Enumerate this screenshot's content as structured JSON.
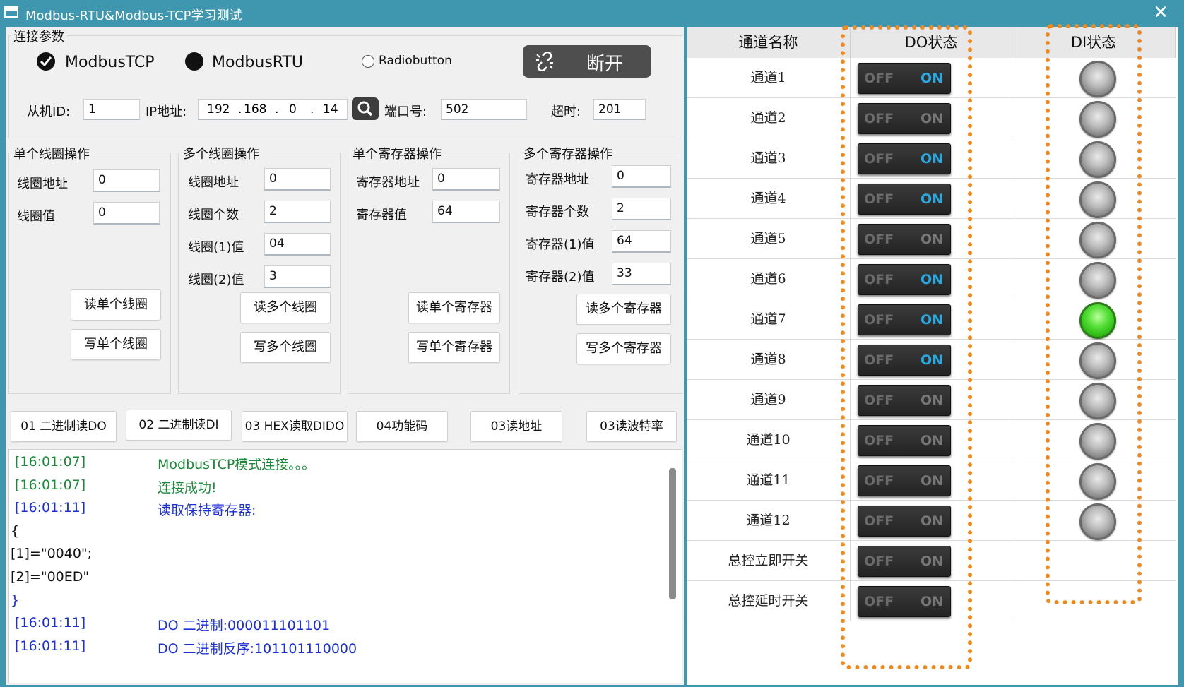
{
  "window": {
    "title": "Modbus-RTU&Modbus-TCP学习测试",
    "close": "✕"
  },
  "connection": {
    "group_title": "连接参数",
    "radio_tcp": "ModbusTCP",
    "radio_rtu": "ModbusRTU",
    "radio_other": "Radiobutton",
    "disconnect_label": "断开",
    "slave_id_label": "从机ID:",
    "slave_id": "1",
    "ip_label": "IP地址:",
    "ip": [
      "192",
      "168",
      "0",
      "14"
    ],
    "port_label": "端口号:",
    "port": "502",
    "timeout_label": "超时:",
    "timeout": "201"
  },
  "single_coil": {
    "title": "单个线圈操作",
    "addr_label": "线圈地址",
    "addr": "0",
    "value_label": "线圈值",
    "value": "0",
    "read_btn": "读单个线圈",
    "write_btn": "写单个线圈"
  },
  "multi_coil": {
    "title": "多个线圈操作",
    "addr_label": "线圈地址",
    "addr": "0",
    "count_label": "线圈个数",
    "count": "2",
    "v1_label": "线圈(1)值",
    "v1": "04",
    "v2_label": "线圈(2)值",
    "v2": "3",
    "read_btn": "读多个线圈",
    "write_btn": "写多个线圈"
  },
  "single_reg": {
    "title": "单个寄存器操作",
    "addr_label": "寄存器地址",
    "addr": "0",
    "value_label": "寄存器值",
    "value": "64",
    "read_btn": "读单个寄存器",
    "write_btn": "写单个寄存器"
  },
  "multi_reg": {
    "title": "多个寄存器操作",
    "addr_label": "寄存器地址",
    "addr": "0",
    "count_label": "寄存器个数",
    "count": "2",
    "v1_label": "寄存器(1)值",
    "v1": "64",
    "v2_label": "寄存器(2)值",
    "v2": "33",
    "read_btn": "读多个寄存器",
    "write_btn": "写多个寄存器"
  },
  "func_buttons": [
    "01 二进制读DO",
    "02 二进制读DI",
    "03 HEX读取DIDO",
    "04功能码",
    "03读地址",
    "03读波特率"
  ],
  "log": [
    {
      "time": "[16:01:07]",
      "text": "ModbusTCP模式连接。。。",
      "color": "#1a8a3a"
    },
    {
      "time": "[16:01:07]",
      "text": "连接成功!",
      "color": "#1a8a3a"
    },
    {
      "time": "[16:01:11]",
      "text": "读取保持寄存器:",
      "color": "#1a2fd6"
    },
    {
      "time": "",
      "text": "{",
      "color": "#111111"
    },
    {
      "time": "",
      "text": "[1]=\"0040\";",
      "color": "#111111"
    },
    {
      "time": "",
      "text": "[2]=\"00ED\"",
      "color": "#111111"
    },
    {
      "time": "",
      "text": "}",
      "color": "#1a2fd6"
    },
    {
      "time": "[16:01:11]",
      "text": "DO 二进制:000011101101",
      "color": "#1a2fd6"
    },
    {
      "time": "[16:01:11]",
      "text": "DO 二进制反序:101101110000",
      "color": "#1a2fd6"
    }
  ],
  "grid": {
    "headers": [
      "通道名称",
      "DO状态",
      "DI状态"
    ],
    "off_text": "OFF",
    "on_text": "ON",
    "rows": [
      {
        "name": "通道1",
        "do_on": true,
        "di_on": false
      },
      {
        "name": "通道2",
        "do_on": false,
        "di_on": false
      },
      {
        "name": "通道3",
        "do_on": true,
        "di_on": false
      },
      {
        "name": "通道4",
        "do_on": true,
        "di_on": false
      },
      {
        "name": "通道5",
        "do_on": false,
        "di_on": false
      },
      {
        "name": "通道6",
        "do_on": true,
        "di_on": false
      },
      {
        "name": "通道7",
        "do_on": true,
        "di_on": true
      },
      {
        "name": "通道8",
        "do_on": true,
        "di_on": false
      },
      {
        "name": "通道9",
        "do_on": false,
        "di_on": false
      },
      {
        "name": "通道10",
        "do_on": false,
        "di_on": false
      },
      {
        "name": "通道11",
        "do_on": false,
        "di_on": false
      },
      {
        "name": "通道12",
        "do_on": false,
        "di_on": false
      },
      {
        "name": "总控立即开关",
        "do_on": false,
        "di_on": null
      },
      {
        "name": "总控延时开关",
        "do_on": false,
        "di_on": null
      }
    ]
  },
  "colors": {
    "window": "#3e97ae",
    "accent_on": "#29a9e1",
    "highlight": "#f08a1e",
    "led_on": "#38c81c"
  }
}
